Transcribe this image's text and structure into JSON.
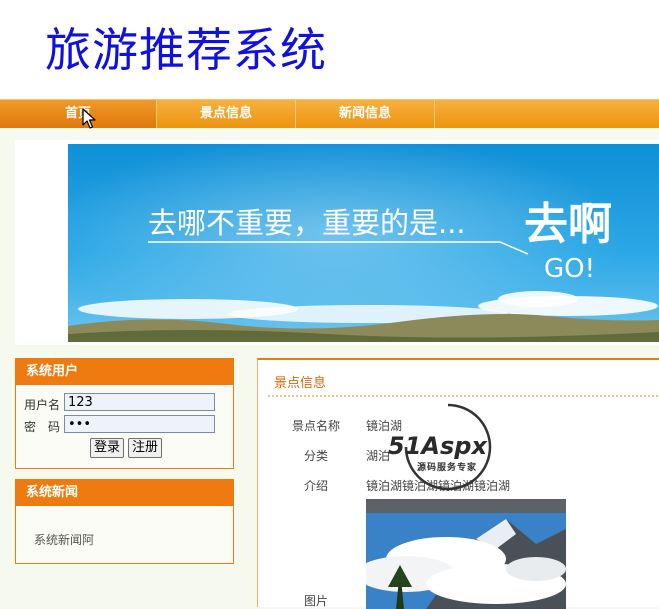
{
  "header": {
    "title": "旅游推荐系统"
  },
  "nav": {
    "items": [
      "首页",
      "景点信息",
      "新闻信息"
    ],
    "active_index": 0
  },
  "banner": {
    "headline": "去哪不重要，重要的是...",
    "big_text": "去啊",
    "go_text": "GO!"
  },
  "login": {
    "title": "系统用户",
    "username_label": "用户名",
    "username_value": "123",
    "password_label": "密　码",
    "password_value": "•••",
    "login_button": "登录",
    "register_button": "注册"
  },
  "news": {
    "title": "系统新闻",
    "item": "系统新闻阿"
  },
  "detail": {
    "title": "景点信息",
    "name_label": "景点名称",
    "name_value": "镜泊湖",
    "category_label": "分类",
    "category_value": "湖泊",
    "intro_label": "介绍",
    "intro_value": "镜泊湖镜泊湖镜泊湖镜泊湖",
    "image_label": "图片"
  },
  "watermark": {
    "brand": "51Aspx",
    "subtitle": "源码服务专家"
  }
}
